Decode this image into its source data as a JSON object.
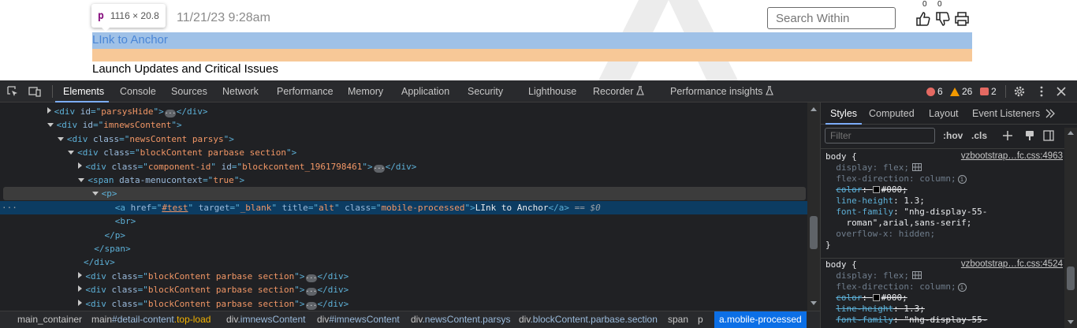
{
  "page": {
    "tooltip": {
      "tag": "p",
      "size": "1116 × 20.8"
    },
    "dateline": "11/21/23 9:28am",
    "search_placeholder": "Search Within",
    "like_count": "0",
    "dislike_count": "0",
    "anchor_text": "LInk to Anchor",
    "heading_text": "Launch Updates and Critical Issues"
  },
  "devtools": {
    "tabs": [
      "Elements",
      "Console",
      "Sources",
      "Network",
      "Performance",
      "Memory",
      "Application",
      "Security",
      "Lighthouse",
      "Recorder",
      "Performance insights"
    ],
    "active_tab": "Elements",
    "errors": "6",
    "warnings": "26",
    "issues": "2",
    "dom_lines": [
      {
        "pre": "          ",
        "expand": "r",
        "tag": "div",
        "attrs": [
          [
            "id",
            "parsysHide"
          ]
        ],
        "collapsed": true
      },
      {
        "pre": "          ",
        "expand": "d",
        "tag": "div",
        "attrs": [
          [
            "id",
            "imnewsContent"
          ]
        ]
      },
      {
        "pre": "            ",
        "expand": "d",
        "tag": "div",
        "attrs": [
          [
            "class",
            "newsContent parsys"
          ]
        ]
      },
      {
        "pre": "              ",
        "expand": "d",
        "tag": "div",
        "attrs": [
          [
            "class",
            "blockContent parbase section"
          ]
        ]
      },
      {
        "pre": "                ",
        "expand": "r",
        "tag": "div",
        "attrs": [
          [
            "class",
            "component-id"
          ],
          [
            "id",
            "blockcontent_1961798461"
          ]
        ],
        "collapsed": true
      },
      {
        "pre": "                ",
        "expand": "d",
        "tag": "span",
        "attrs": [
          [
            "data-menucontext",
            "true"
          ]
        ]
      },
      {
        "pre": "                  ",
        "expand": "d",
        "tag": "p",
        "attrs": [],
        "hover": true
      },
      {
        "pre": "                      ",
        "tag": "a",
        "attrs": [
          [
            "href",
            "#test"
          ],
          [
            "target",
            "_blank"
          ],
          [
            "title",
            "alt"
          ],
          [
            "class",
            "mobile-processed"
          ]
        ],
        "text": "LInk to Anchor",
        "close": "a",
        "selected": true,
        "suffix": " == $0"
      },
      {
        "pre": "                      ",
        "tag": "br",
        "attrs": []
      },
      {
        "pre": "                    ",
        "closeonly": "p"
      },
      {
        "pre": "                  ",
        "closeonly": "span"
      },
      {
        "pre": "                ",
        "closeonly": "div"
      },
      {
        "pre": "                ",
        "expand": "r",
        "tag": "div",
        "attrs": [
          [
            "class",
            "blockContent parbase section"
          ]
        ],
        "collapsed": true
      },
      {
        "pre": "                ",
        "expand": "r",
        "tag": "div",
        "attrs": [
          [
            "class",
            "blockContent parbase section"
          ]
        ],
        "collapsed": true
      },
      {
        "pre": "                ",
        "expand": "r",
        "tag": "div",
        "attrs": [
          [
            "class",
            "blockContent parbase section"
          ]
        ],
        "collapsed": true
      }
    ],
    "breadcrumbs": [
      {
        "tag": "main_container",
        "rest": ""
      },
      {
        "tag": "main",
        "rest": "#detail-content",
        "extra": ".top-load"
      },
      {
        "tag": "div",
        "rest": ".imnewsContent"
      },
      {
        "tag": "div",
        "rest": "#imnewsContent"
      },
      {
        "tag": "div",
        "rest": ".newsContent.parsys"
      },
      {
        "tag": "div",
        "rest": ".blockContent.parbase.section"
      },
      {
        "tag": "span",
        "rest": ""
      },
      {
        "tag": "p",
        "rest": ""
      },
      {
        "tag": "a",
        "rest": ".mobile-processed",
        "active": true
      }
    ],
    "side_tabs": [
      "Styles",
      "Computed",
      "Layout",
      "Event Listeners"
    ],
    "filter_placeholder": "Filter",
    "hov": ":hov",
    "cls": ".cls",
    "rules": [
      {
        "selector": "body {",
        "source": "vzbootstrap…fc.css:4963",
        "props": [
          {
            "name": "display",
            "value": "flex;",
            "dim": true,
            "grid": true
          },
          {
            "name": "flex-direction",
            "value": "column;",
            "dim": true,
            "info": true
          },
          {
            "name": "color",
            "value": "#000;",
            "struck": true,
            "swatch": true
          },
          {
            "name": "line-height",
            "value": "1.3;"
          },
          {
            "name": "font-family",
            "value": "\"nhg-display-55-\n    roman\",arial,sans-serif;"
          },
          {
            "name": "overflow-x",
            "value": "hidden;",
            "dim": true
          }
        ]
      },
      {
        "selector": "body {",
        "source": "vzbootstrap…fc.css:4524",
        "props": [
          {
            "name": "display",
            "value": "flex;",
            "dim": true,
            "grid": true
          },
          {
            "name": "flex-direction",
            "value": "column;",
            "dim": true,
            "info": true
          },
          {
            "name": "color",
            "value": "#000;",
            "struck": true,
            "swatch": true
          },
          {
            "name": "line-height",
            "value": "1.3;",
            "struck": true
          },
          {
            "name": "font-family",
            "value": "\"nhg-display-55-",
            "struck": true
          }
        ]
      }
    ]
  },
  "colors": {
    "accent": "#7cacf8",
    "selected_row": "#0c3c62",
    "active_crumb": "#0c6fe6",
    "highlight_content": "#9fc1e7",
    "highlight_padding": "#f7c897"
  }
}
